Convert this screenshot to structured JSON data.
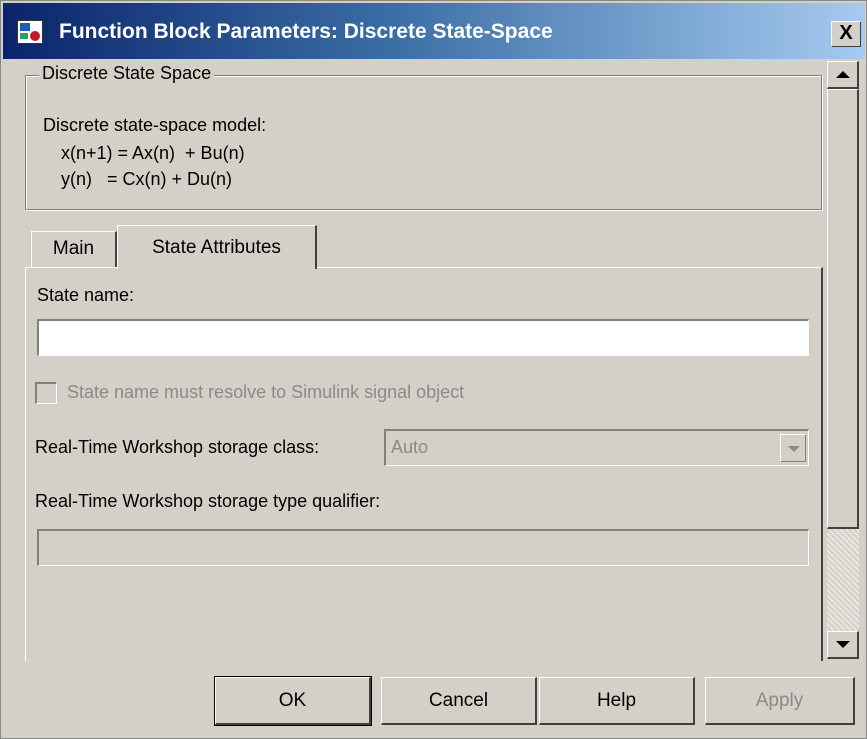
{
  "window": {
    "title": "Function Block Parameters: Discrete State-Space",
    "close_label": "X"
  },
  "description": {
    "group_title": "Discrete State Space",
    "heading": "Discrete state-space model:",
    "eq1": "x(n+1) = Ax(n)  + Bu(n)",
    "eq2": "y(n)   = Cx(n) + Du(n)"
  },
  "tabs": [
    {
      "label": "Main",
      "active": false
    },
    {
      "label": "State Attributes",
      "active": true
    }
  ],
  "state_attributes": {
    "state_name_label": "State name:",
    "state_name_value": "",
    "resolve_checkbox_label": "State name must resolve to Simulink signal object",
    "resolve_checked": false,
    "storage_class_label": "Real-Time Workshop storage class:",
    "storage_class_value": "Auto",
    "type_qualifier_label": "Real-Time Workshop storage type qualifier:",
    "type_qualifier_value": ""
  },
  "buttons": {
    "ok": "OK",
    "cancel": "Cancel",
    "help": "Help",
    "apply": "Apply"
  },
  "colors": {
    "titlebar_start": "#0a246a",
    "titlebar_end": "#a6caf0",
    "dialog_bg": "#d4d0c8",
    "disabled_text": "#8a8a8a"
  }
}
